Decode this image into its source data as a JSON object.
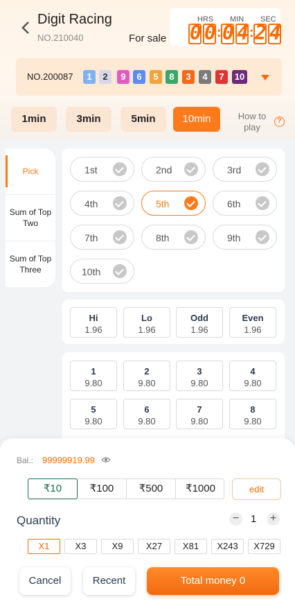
{
  "header": {
    "title": "Digit Racing",
    "issue_no": "NO.210040",
    "status": "For sale",
    "timer": {
      "labels": [
        "HRS",
        "MIN",
        "SEC"
      ],
      "digits": [
        "0",
        "0",
        "0",
        "4",
        "2",
        "4"
      ]
    }
  },
  "last_result": {
    "issue_no": "NO.200087",
    "balls": [
      {
        "n": "1",
        "color": "#7fb2f0"
      },
      {
        "n": "2",
        "color": "#d8d8e6"
      },
      {
        "n": "9",
        "color": "#e35bc0"
      },
      {
        "n": "6",
        "color": "#5b8cf0"
      },
      {
        "n": "5",
        "color": "#f2a33a"
      },
      {
        "n": "8",
        "color": "#3aa66a"
      },
      {
        "n": "3",
        "color": "#f06a1a"
      },
      {
        "n": "4",
        "color": "#7a7a7a"
      },
      {
        "n": "7",
        "color": "#e03535"
      },
      {
        "n": "10",
        "color": "#6b2a7a"
      }
    ]
  },
  "period_tabs": [
    {
      "label": "1min",
      "active": false
    },
    {
      "label": "3min",
      "active": false
    },
    {
      "label": "5min",
      "active": false
    },
    {
      "label": "10min",
      "active": true
    }
  ],
  "how_to_play": "How to play",
  "side_nav": [
    {
      "label": "Pick",
      "active": true
    },
    {
      "label": "Sum of Top Two",
      "active": false
    },
    {
      "label": "Sum of Top Three",
      "active": false
    }
  ],
  "positions": [
    {
      "label": "1st",
      "active": false
    },
    {
      "label": "2nd",
      "active": false
    },
    {
      "label": "3rd",
      "active": false
    },
    {
      "label": "4th",
      "active": false
    },
    {
      "label": "5th",
      "active": true
    },
    {
      "label": "6th",
      "active": false
    },
    {
      "label": "7th",
      "active": false
    },
    {
      "label": "8th",
      "active": false
    },
    {
      "label": "9th",
      "active": false
    },
    {
      "label": "10th",
      "active": false
    }
  ],
  "hilo": [
    {
      "label": "Hi",
      "odds": "1.96"
    },
    {
      "label": "Lo",
      "odds": "1.96"
    },
    {
      "label": "Odd",
      "odds": "1.96"
    },
    {
      "label": "Even",
      "odds": "1.96"
    }
  ],
  "numbers": [
    {
      "label": "1",
      "odds": "9.80"
    },
    {
      "label": "2",
      "odds": "9.80"
    },
    {
      "label": "3",
      "odds": "9.80"
    },
    {
      "label": "4",
      "odds": "9.80"
    },
    {
      "label": "5",
      "odds": "9.80"
    },
    {
      "label": "6",
      "odds": "9.80"
    },
    {
      "label": "7",
      "odds": "9.80"
    },
    {
      "label": "8",
      "odds": "9.80"
    }
  ],
  "bet": {
    "balance_label": "Bal.:",
    "balance": "99999919.99",
    "chips": [
      {
        "label": "₹10",
        "active": true
      },
      {
        "label": "₹100",
        "active": false
      },
      {
        "label": "₹500",
        "active": false
      },
      {
        "label": "₹1000",
        "active": false
      }
    ],
    "edit_label": "edit",
    "quantity_label": "Quantity",
    "quantity_value": "1",
    "multipliers": [
      {
        "label": "X1",
        "active": true
      },
      {
        "label": "X3",
        "active": false
      },
      {
        "label": "X9",
        "active": false
      },
      {
        "label": "X27",
        "active": false
      },
      {
        "label": "X81",
        "active": false
      },
      {
        "label": "X243",
        "active": false
      },
      {
        "label": "X729",
        "active": false
      }
    ],
    "cancel_label": "Cancel",
    "recent_label": "Recent",
    "total_label": "Total money 0"
  }
}
